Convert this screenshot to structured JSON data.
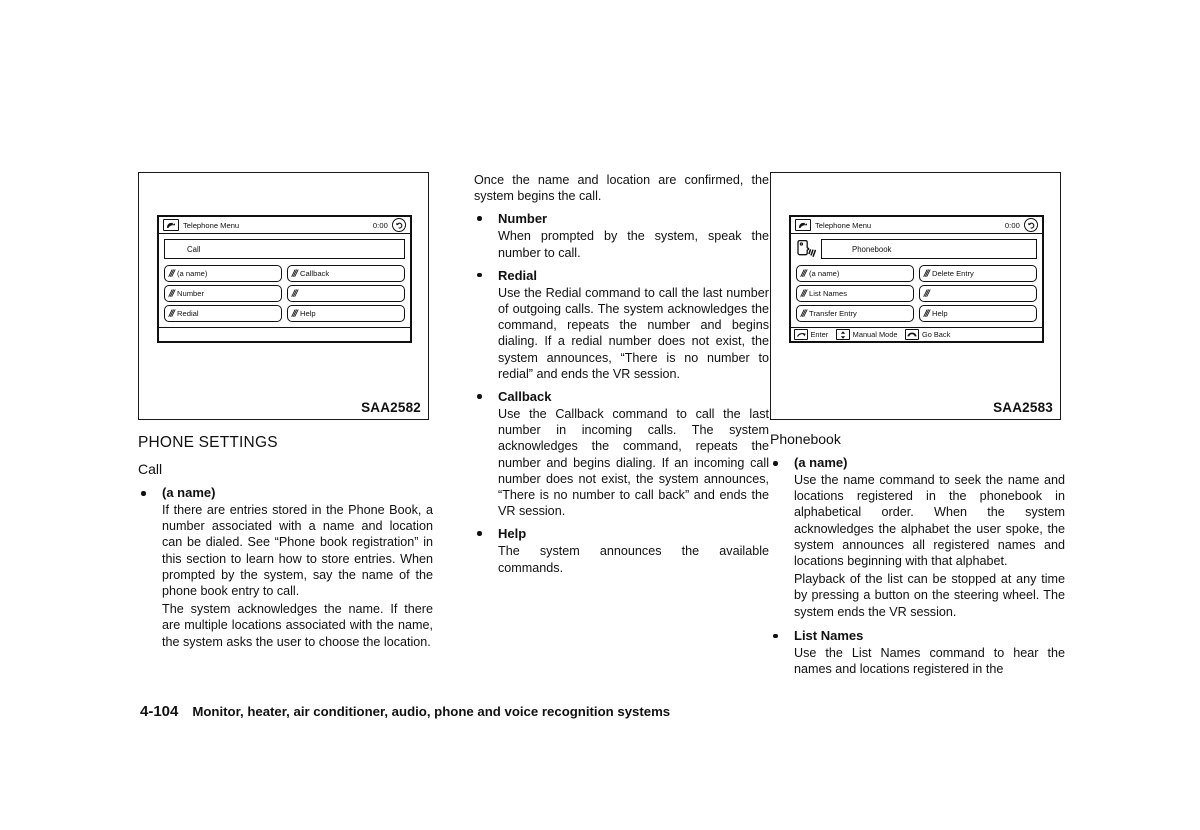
{
  "page": {
    "footer_page_number": "4-104",
    "footer_title": "Monitor, heater, air conditioner, audio, phone and voice recognition systems"
  },
  "figures": [
    {
      "caption": "SAA2582",
      "screen": {
        "titlebar": {
          "icon": "phone-handset-icon",
          "title": "Telephone Menu",
          "clock": "0:00",
          "back_icon": "back-arrow-icon"
        },
        "field": "Call",
        "buttons": [
          {
            "glyph": "voice-command-icon",
            "label": "(a name)"
          },
          {
            "glyph": "voice-command-icon",
            "label": "Callback"
          },
          {
            "glyph": "voice-command-icon",
            "label": "Number"
          },
          {
            "glyph": "voice-command-icon",
            "label": ""
          },
          {
            "glyph": "voice-command-icon",
            "label": "Redial"
          },
          {
            "glyph": "voice-command-icon",
            "label": "Help"
          }
        ],
        "statusbar": []
      }
    },
    {
      "caption": "SAA2583",
      "screen": {
        "titlebar": {
          "icon": "phone-handset-icon",
          "title": "Telephone Menu",
          "clock": "0:00",
          "back_icon": "back-arrow-icon"
        },
        "field": "Phonebook",
        "face_icon": "speaking-head-icon",
        "buttons": [
          {
            "glyph": "voice-command-icon",
            "label": "(a name)"
          },
          {
            "glyph": "voice-command-icon",
            "label": "Delete Entry"
          },
          {
            "glyph": "voice-command-icon",
            "label": "List Names"
          },
          {
            "glyph": "voice-command-icon",
            "label": ""
          },
          {
            "glyph": "voice-command-icon",
            "label": "Transfer Entry"
          },
          {
            "glyph": "voice-command-icon",
            "label": "Help"
          }
        ],
        "statusbar": [
          {
            "icon": "enter-button-icon",
            "label": "Enter"
          },
          {
            "icon": "updown-button-icon",
            "label": "Manual Mode"
          },
          {
            "icon": "hangup-button-icon",
            "label": "Go Back"
          }
        ]
      }
    }
  ],
  "left_column": {
    "section_heading": "PHONE SETTINGS",
    "sub_heading": "Call",
    "bullets": [
      {
        "title": "(a name)",
        "paragraphs": [
          "If there are entries stored in the Phone Book, a number associated with a name and location can be dialed. See “Phone book registration” in this section to learn how to store entries. When prompted by the system, say the name of the phone book entry to call.",
          "The system acknowledges the name. If there are multiple locations associated with the name, the system asks the user to choose the location."
        ]
      }
    ]
  },
  "middle_column": {
    "lead_paragraph": "Once the name and location are confirmed, the system begins the call.",
    "bullets": [
      {
        "title": "Number",
        "paragraphs": [
          "When prompted by the system, speak the number to call."
        ]
      },
      {
        "title": "Redial",
        "paragraphs": [
          "Use the Redial command to call the last number of outgoing calls. The system acknowledges the command, repeats the number and begins dialing. If a redial number does not exist, the system announces, “There is no number to redial” and ends the VR session."
        ]
      },
      {
        "title": "Callback",
        "paragraphs": [
          "Use the Callback command to call the last number in incoming calls. The system acknowledges the command, repeats the number and begins dialing. If an incoming call number does not exist, the system announces, “There is no number to call back” and ends the VR session."
        ]
      },
      {
        "title": "Help",
        "paragraphs": [
          "The system announces the available commands."
        ]
      }
    ]
  },
  "right_column": {
    "sub_heading": "Phonebook",
    "bullets": [
      {
        "title": "(a name)",
        "paragraphs": [
          "Use the name command to seek the name and locations registered in the phonebook in alphabetical order. When the system acknowledges the alphabet the user spoke, the system announces all registered names and locations beginning with that alphabet.",
          "Playback of the list can be stopped at any time by pressing a button on the steering wheel. The system ends the VR session."
        ]
      },
      {
        "title": "List Names",
        "paragraphs": [
          "Use the List Names command to hear the names and locations registered in the"
        ]
      }
    ]
  }
}
